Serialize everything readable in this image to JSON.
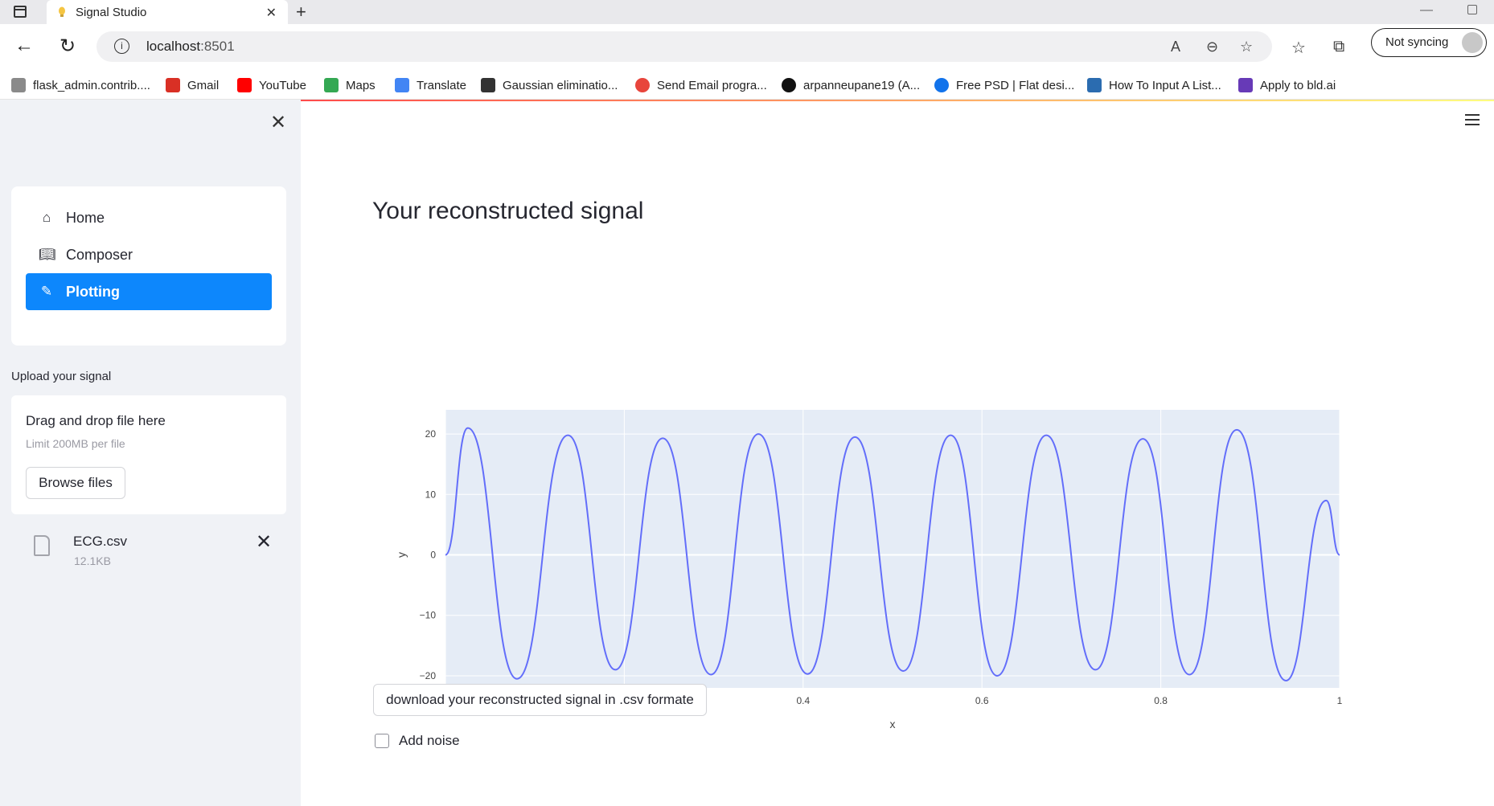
{
  "browser": {
    "tab_title": "Signal Studio",
    "url_host": "localhost",
    "url_port": ":8501",
    "sync_label": "Not syncing",
    "bookmarks": [
      {
        "label": "flask_admin.contrib....",
        "icon": "image-icon",
        "color": "#8a8a8a"
      },
      {
        "label": "Gmail",
        "icon": "gmail-icon",
        "color": "#d93025"
      },
      {
        "label": "YouTube",
        "icon": "youtube-icon",
        "color": "#ff0000"
      },
      {
        "label": "Maps",
        "icon": "maps-icon",
        "color": "#34a853"
      },
      {
        "label": "Translate",
        "icon": "translate-icon",
        "color": "#4285f4"
      },
      {
        "label": "Gaussian eliminatio...",
        "icon": "math-icon",
        "color": "#333333"
      },
      {
        "label": "Send Email progra...",
        "icon": "email-program-icon",
        "color": "#e8453c"
      },
      {
        "label": "arpanneupane19 (A...",
        "icon": "github-icon",
        "color": "#111111"
      },
      {
        "label": "Free PSD | Flat desi...",
        "icon": "freepik-icon",
        "color": "#1273eb"
      },
      {
        "label": "How To Input A List...",
        "icon": "educative-icon",
        "color": "#2b6cb0"
      },
      {
        "label": "Apply to bld.ai",
        "icon": "form-icon",
        "color": "#673ab7"
      }
    ]
  },
  "sidebar": {
    "nav": [
      {
        "label": "Home",
        "icon": "home-icon"
      },
      {
        "label": "Composer",
        "icon": "book-icon"
      },
      {
        "label": "Plotting",
        "icon": "pen-icon"
      }
    ],
    "active_index": 2,
    "upload_label": "Upload your signal",
    "dropzone_title": "Drag and drop file here",
    "dropzone_limit": "Limit 200MB per file",
    "browse_label": "Browse files",
    "file_name": "ECG.csv",
    "file_size": "12.1KB"
  },
  "main": {
    "title": "Your reconstructed signal",
    "download_label": "download your reconstructed signal in .csv formate",
    "noise_label": "Add noise",
    "noise_checked": false
  },
  "chart_data": {
    "type": "line",
    "title": "",
    "xlabel": "x",
    "ylabel": "y",
    "xlim": [
      0,
      1
    ],
    "ylim": [
      -22,
      24
    ],
    "xticks": [
      0,
      0.2,
      0.4,
      0.6,
      0.8,
      1
    ],
    "xtick_labels": [
      "0",
      "0.2",
      "0.4",
      "0.6",
      "0.8",
      "1"
    ],
    "yticks": [
      -20,
      -10,
      0,
      10,
      20
    ],
    "ytick_labels": [
      "−20",
      "−10",
      "0",
      "10",
      "20"
    ],
    "grid": true,
    "line_color": "#636efa",
    "plot_bg": "#e5ecf6",
    "series": [
      {
        "x": [
          0,
          0.025,
          0.08,
          0.137,
          0.19,
          0.243,
          0.297,
          0.35,
          0.405,
          0.458,
          0.512,
          0.565,
          0.617,
          0.672,
          0.727,
          0.78,
          0.832,
          0.885,
          0.94,
          0.985,
          1.0
        ],
        "values": [
          0,
          21,
          -20.5,
          19.8,
          -19,
          19.3,
          -19.8,
          20,
          -19.7,
          19.5,
          -19.2,
          19.8,
          -20,
          19.8,
          -19,
          19.2,
          -19.8,
          20.7,
          -20.8,
          9,
          0
        ]
      }
    ]
  }
}
